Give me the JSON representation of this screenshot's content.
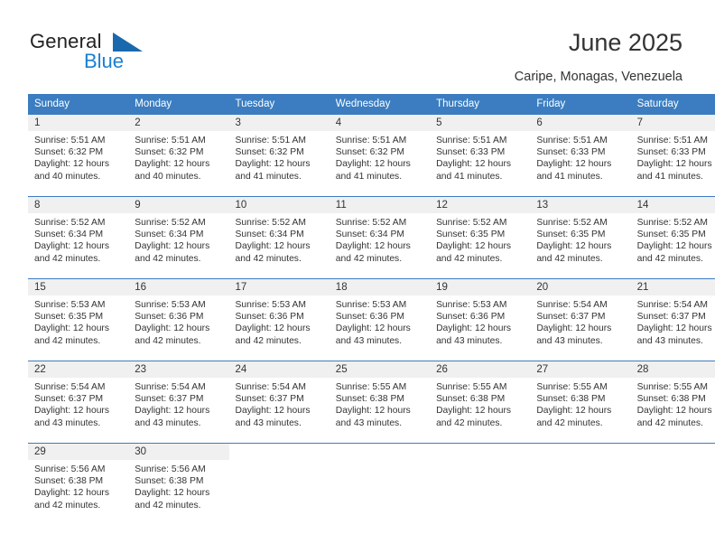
{
  "brand": {
    "logo_primary": "General",
    "logo_secondary": "Blue",
    "accent_blue": "#3b7dc0",
    "logo_blue": "#1a7fd4"
  },
  "header": {
    "title": "June 2025",
    "subtitle": "Caripe, Monagas, Venezuela"
  },
  "calendar": {
    "weekday_headers": [
      "Sunday",
      "Monday",
      "Tuesday",
      "Wednesday",
      "Thursday",
      "Friday",
      "Saturday"
    ],
    "weeks": [
      [
        {
          "day": "1",
          "sunrise": "Sunrise: 5:51 AM",
          "sunset": "Sunset: 6:32 PM",
          "daylight1": "Daylight: 12 hours",
          "daylight2": "and 40 minutes."
        },
        {
          "day": "2",
          "sunrise": "Sunrise: 5:51 AM",
          "sunset": "Sunset: 6:32 PM",
          "daylight1": "Daylight: 12 hours",
          "daylight2": "and 40 minutes."
        },
        {
          "day": "3",
          "sunrise": "Sunrise: 5:51 AM",
          "sunset": "Sunset: 6:32 PM",
          "daylight1": "Daylight: 12 hours",
          "daylight2": "and 41 minutes."
        },
        {
          "day": "4",
          "sunrise": "Sunrise: 5:51 AM",
          "sunset": "Sunset: 6:32 PM",
          "daylight1": "Daylight: 12 hours",
          "daylight2": "and 41 minutes."
        },
        {
          "day": "5",
          "sunrise": "Sunrise: 5:51 AM",
          "sunset": "Sunset: 6:33 PM",
          "daylight1": "Daylight: 12 hours",
          "daylight2": "and 41 minutes."
        },
        {
          "day": "6",
          "sunrise": "Sunrise: 5:51 AM",
          "sunset": "Sunset: 6:33 PM",
          "daylight1": "Daylight: 12 hours",
          "daylight2": "and 41 minutes."
        },
        {
          "day": "7",
          "sunrise": "Sunrise: 5:51 AM",
          "sunset": "Sunset: 6:33 PM",
          "daylight1": "Daylight: 12 hours",
          "daylight2": "and 41 minutes."
        }
      ],
      [
        {
          "day": "8",
          "sunrise": "Sunrise: 5:52 AM",
          "sunset": "Sunset: 6:34 PM",
          "daylight1": "Daylight: 12 hours",
          "daylight2": "and 42 minutes."
        },
        {
          "day": "9",
          "sunrise": "Sunrise: 5:52 AM",
          "sunset": "Sunset: 6:34 PM",
          "daylight1": "Daylight: 12 hours",
          "daylight2": "and 42 minutes."
        },
        {
          "day": "10",
          "sunrise": "Sunrise: 5:52 AM",
          "sunset": "Sunset: 6:34 PM",
          "daylight1": "Daylight: 12 hours",
          "daylight2": "and 42 minutes."
        },
        {
          "day": "11",
          "sunrise": "Sunrise: 5:52 AM",
          "sunset": "Sunset: 6:34 PM",
          "daylight1": "Daylight: 12 hours",
          "daylight2": "and 42 minutes."
        },
        {
          "day": "12",
          "sunrise": "Sunrise: 5:52 AM",
          "sunset": "Sunset: 6:35 PM",
          "daylight1": "Daylight: 12 hours",
          "daylight2": "and 42 minutes."
        },
        {
          "day": "13",
          "sunrise": "Sunrise: 5:52 AM",
          "sunset": "Sunset: 6:35 PM",
          "daylight1": "Daylight: 12 hours",
          "daylight2": "and 42 minutes."
        },
        {
          "day": "14",
          "sunrise": "Sunrise: 5:52 AM",
          "sunset": "Sunset: 6:35 PM",
          "daylight1": "Daylight: 12 hours",
          "daylight2": "and 42 minutes."
        }
      ],
      [
        {
          "day": "15",
          "sunrise": "Sunrise: 5:53 AM",
          "sunset": "Sunset: 6:35 PM",
          "daylight1": "Daylight: 12 hours",
          "daylight2": "and 42 minutes."
        },
        {
          "day": "16",
          "sunrise": "Sunrise: 5:53 AM",
          "sunset": "Sunset: 6:36 PM",
          "daylight1": "Daylight: 12 hours",
          "daylight2": "and 42 minutes."
        },
        {
          "day": "17",
          "sunrise": "Sunrise: 5:53 AM",
          "sunset": "Sunset: 6:36 PM",
          "daylight1": "Daylight: 12 hours",
          "daylight2": "and 42 minutes."
        },
        {
          "day": "18",
          "sunrise": "Sunrise: 5:53 AM",
          "sunset": "Sunset: 6:36 PM",
          "daylight1": "Daylight: 12 hours",
          "daylight2": "and 43 minutes."
        },
        {
          "day": "19",
          "sunrise": "Sunrise: 5:53 AM",
          "sunset": "Sunset: 6:36 PM",
          "daylight1": "Daylight: 12 hours",
          "daylight2": "and 43 minutes."
        },
        {
          "day": "20",
          "sunrise": "Sunrise: 5:54 AM",
          "sunset": "Sunset: 6:37 PM",
          "daylight1": "Daylight: 12 hours",
          "daylight2": "and 43 minutes."
        },
        {
          "day": "21",
          "sunrise": "Sunrise: 5:54 AM",
          "sunset": "Sunset: 6:37 PM",
          "daylight1": "Daylight: 12 hours",
          "daylight2": "and 43 minutes."
        }
      ],
      [
        {
          "day": "22",
          "sunrise": "Sunrise: 5:54 AM",
          "sunset": "Sunset: 6:37 PM",
          "daylight1": "Daylight: 12 hours",
          "daylight2": "and 43 minutes."
        },
        {
          "day": "23",
          "sunrise": "Sunrise: 5:54 AM",
          "sunset": "Sunset: 6:37 PM",
          "daylight1": "Daylight: 12 hours",
          "daylight2": "and 43 minutes."
        },
        {
          "day": "24",
          "sunrise": "Sunrise: 5:54 AM",
          "sunset": "Sunset: 6:37 PM",
          "daylight1": "Daylight: 12 hours",
          "daylight2": "and 43 minutes."
        },
        {
          "day": "25",
          "sunrise": "Sunrise: 5:55 AM",
          "sunset": "Sunset: 6:38 PM",
          "daylight1": "Daylight: 12 hours",
          "daylight2": "and 43 minutes."
        },
        {
          "day": "26",
          "sunrise": "Sunrise: 5:55 AM",
          "sunset": "Sunset: 6:38 PM",
          "daylight1": "Daylight: 12 hours",
          "daylight2": "and 42 minutes."
        },
        {
          "day": "27",
          "sunrise": "Sunrise: 5:55 AM",
          "sunset": "Sunset: 6:38 PM",
          "daylight1": "Daylight: 12 hours",
          "daylight2": "and 42 minutes."
        },
        {
          "day": "28",
          "sunrise": "Sunrise: 5:55 AM",
          "sunset": "Sunset: 6:38 PM",
          "daylight1": "Daylight: 12 hours",
          "daylight2": "and 42 minutes."
        }
      ],
      [
        {
          "day": "29",
          "sunrise": "Sunrise: 5:56 AM",
          "sunset": "Sunset: 6:38 PM",
          "daylight1": "Daylight: 12 hours",
          "daylight2": "and 42 minutes."
        },
        {
          "day": "30",
          "sunrise": "Sunrise: 5:56 AM",
          "sunset": "Sunset: 6:38 PM",
          "daylight1": "Daylight: 12 hours",
          "daylight2": "and 42 minutes."
        },
        {
          "day": "",
          "sunrise": "",
          "sunset": "",
          "daylight1": "",
          "daylight2": ""
        },
        {
          "day": "",
          "sunrise": "",
          "sunset": "",
          "daylight1": "",
          "daylight2": ""
        },
        {
          "day": "",
          "sunrise": "",
          "sunset": "",
          "daylight1": "",
          "daylight2": ""
        },
        {
          "day": "",
          "sunrise": "",
          "sunset": "",
          "daylight1": "",
          "daylight2": ""
        },
        {
          "day": "",
          "sunrise": "",
          "sunset": "",
          "daylight1": "",
          "daylight2": ""
        }
      ]
    ]
  }
}
